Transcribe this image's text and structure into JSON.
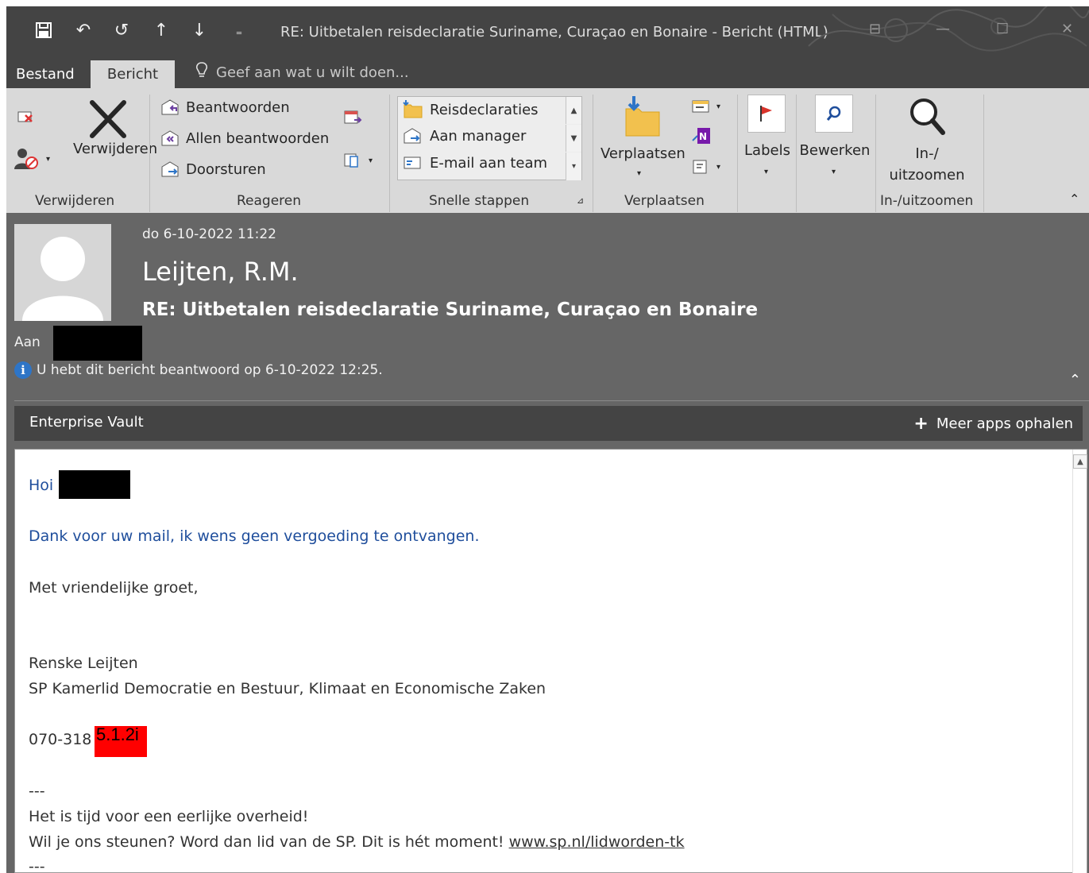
{
  "window": {
    "title": "RE: Uitbetalen reisdeclaratie Suriname, Curaçao en Bonaire  -  Bericht (HTML)",
    "quick_access": [
      "save-icon",
      "undo-icon",
      "redo-icon",
      "up-arrow-icon",
      "down-arrow-icon",
      "customize-icon"
    ]
  },
  "tabs": {
    "bestand": "Bestand",
    "bericht": "Bericht",
    "tell_me": "Geef aan wat u wilt doen..."
  },
  "ribbon": {
    "verwijderen": {
      "label": "Verwijderen",
      "delete_button": "Verwijderen"
    },
    "reageren": {
      "label": "Reageren",
      "beantwoorden": "Beantwoorden",
      "allen_beantwoorden": "Allen beantwoorden",
      "doorsturen": "Doorsturen"
    },
    "snelle_stappen": {
      "label": "Snelle stappen",
      "items": [
        "Reisdeclaraties",
        "Aan manager",
        "E-mail aan team"
      ]
    },
    "verplaatsen": {
      "label": "Verplaatsen",
      "button": "Verplaatsen"
    },
    "labels": {
      "button": "Labels"
    },
    "bewerken": {
      "button": "Bewerken"
    },
    "zoom": {
      "label": "In-/uitzoomen",
      "button_line1": "In-/",
      "button_line2": "uitzoomen"
    }
  },
  "message": {
    "date": "do 6-10-2022 11:22",
    "sender": "Leijten, R.M.",
    "subject": "RE: Uitbetalen reisdeclaratie Suriname, Curaçao en Bonaire",
    "to_label": "Aan",
    "info": "U hebt dit bericht beantwoord op 6-10-2022 12:25."
  },
  "appbar": {
    "left": "Enterprise Vault",
    "right": "Meer apps ophalen"
  },
  "body": {
    "greeting": "Hoi",
    "line1": "Dank voor uw mail, ik wens geen vergoeding te ontvangen.",
    "closing": "Met vriendelijke groet,",
    "name": "Renske Leijten",
    "role": "SP Kamerlid Democratie en Bestuur, Klimaat en Economische Zaken",
    "phone": "070-318",
    "phone_redaction": "5.1.2i",
    "dashes1": "---",
    "slogan": "Het is tijd voor een eerlijke overheid!",
    "support": "Wil je ons steunen? Word dan lid van de SP. Dit is hét moment! ",
    "link": "www.sp.nl/lidworden-tk",
    "dashes2": "---"
  }
}
